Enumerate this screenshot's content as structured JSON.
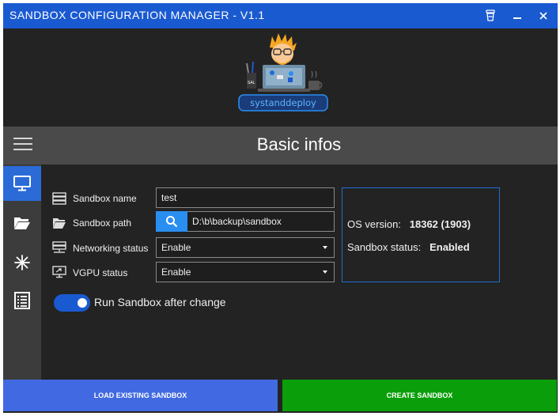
{
  "window": {
    "title": "SANDBOX CONFIGURATION MANAGER - V1.1",
    "logo_text": "systanddeploy"
  },
  "header": {
    "title": "Basic infos"
  },
  "sidebar": {
    "items": [
      {
        "icon": "monitor-icon",
        "active": true
      },
      {
        "icon": "folder-icon",
        "active": false
      },
      {
        "icon": "snowflake-icon",
        "active": false
      },
      {
        "icon": "list-icon",
        "active": false
      }
    ]
  },
  "form": {
    "sandbox_name": {
      "label": "Sandbox name",
      "value": "test"
    },
    "sandbox_path": {
      "label": "Sandbox path",
      "value": "D:\\b\\backup\\sandbox"
    },
    "networking": {
      "label": "Networking status",
      "value": "Enable"
    },
    "vgpu": {
      "label": "VGPU status",
      "value": "Enable"
    },
    "run_after_change": {
      "label": "Run Sandbox after change",
      "on": true
    }
  },
  "info": {
    "os_version_label": "OS version:",
    "os_version_value": "18362 (1903)",
    "status_label": "Sandbox status:",
    "status_value": "Enabled"
  },
  "actions": {
    "load_label": "LOAD EXISTING SANDBOX",
    "create_label": "CREATE SANDBOX"
  },
  "colors": {
    "accent": "#1a5ad1",
    "load_button": "#4169e1",
    "create_button": "#0a9e0a",
    "background": "#232323"
  }
}
